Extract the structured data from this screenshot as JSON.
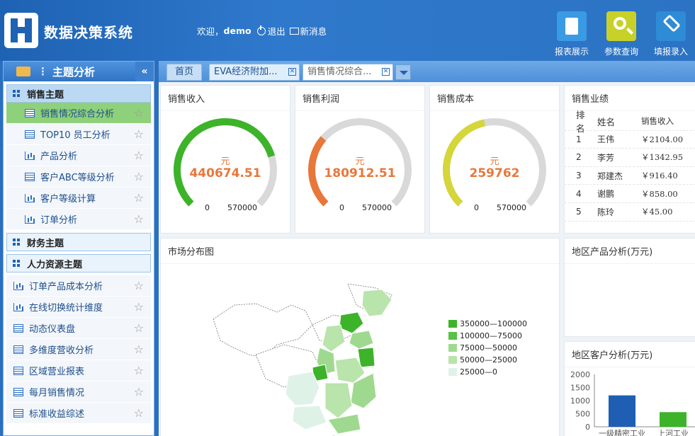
{
  "app": {
    "title": "数据决策系统"
  },
  "topbar": {
    "welcome": "欢迎，",
    "user": "demo",
    "logout": "退出",
    "messages": "新消息"
  },
  "toolbar": [
    {
      "label": "报表展示",
      "icon": "report-icon"
    },
    {
      "label": "参数查询",
      "icon": "search-icon"
    },
    {
      "label": "填报录入",
      "icon": "tag-icon"
    }
  ],
  "sidebar": {
    "title": "主题分析",
    "groups": {
      "sales": "销售主题",
      "finance": "财务主题",
      "hr": "人力资源主题"
    },
    "sales_items": [
      {
        "label": "销售情况综合分析",
        "icon": "list-icon"
      },
      {
        "label": "TOP10 员工分析",
        "icon": "list-icon"
      },
      {
        "label": "产品分析",
        "icon": "bar-chart-icon"
      },
      {
        "label": "客户ABC等级分析",
        "icon": "list-icon"
      },
      {
        "label": "客户等级计算",
        "icon": "bar-chart-icon"
      },
      {
        "label": "订单分析",
        "icon": "bar-chart-icon"
      }
    ],
    "top_items": [
      {
        "label": "订单产品成本分析",
        "icon": "bar-chart-icon"
      },
      {
        "label": "在线切换统计维度",
        "icon": "bar-chart-icon"
      },
      {
        "label": "动态仪表盘",
        "icon": "list-icon"
      },
      {
        "label": "多维度营收分析",
        "icon": "list-icon"
      },
      {
        "label": "区域营业报表",
        "icon": "list-icon"
      },
      {
        "label": "每月销售情况",
        "icon": "list-icon"
      },
      {
        "label": "标准收益综述",
        "icon": "list-icon"
      }
    ]
  },
  "tabs": {
    "home": "首页",
    "t1": "EVA经济附加...",
    "t2": "销售情况综合..."
  },
  "gauges": [
    {
      "title": "销售收入",
      "unit": "元",
      "value": "440674.51",
      "min": "0",
      "max": "570000",
      "color": "#3db32a",
      "ratio": 0.7731
    },
    {
      "title": "销售利润",
      "unit": "元",
      "value": "180912.51",
      "min": "0",
      "max": "570000",
      "color": "#e8773a",
      "ratio": 0.3174
    },
    {
      "title": "销售成本",
      "unit": "元",
      "value": "259762",
      "min": "0",
      "max": "570000",
      "color": "#d4d63a",
      "ratio": 0.4557
    }
  ],
  "ranking": {
    "title": "销售业绩",
    "headers": [
      "排名",
      "姓名",
      "销售收入"
    ],
    "rows": [
      [
        "1",
        "王伟",
        "￥2104.00"
      ],
      [
        "2",
        "李芳",
        "￥1342.95"
      ],
      [
        "3",
        "郑建杰",
        "￥916.40"
      ],
      [
        "4",
        "谢鹏",
        "￥858.00"
      ],
      [
        "5",
        "陈玲",
        "￥45.00"
      ]
    ]
  },
  "market": {
    "title": "市场分布图",
    "legend": [
      {
        "label": "350000—100000",
        "color": "#3db32a"
      },
      {
        "label": "100000—75000",
        "color": "#58c245"
      },
      {
        "label": "75000—50000",
        "color": "#9fd98f"
      },
      {
        "label": "50000—25000",
        "color": "#b9e4ac"
      },
      {
        "label": "25000—0",
        "color": "#dff2e8"
      }
    ]
  },
  "region_product": {
    "title": "地区产品分析(万元)"
  },
  "region_customer": {
    "title": "地区客户分析(万元)"
  },
  "chart_data": {
    "type": "bar",
    "categories": [
      "一级精密工业",
      "上河工业"
    ],
    "values": [
      1200,
      560
    ],
    "colors": [
      "#1e5fb3",
      "#3db32a"
    ],
    "yticks": [
      0,
      500,
      1000,
      1500,
      2000
    ],
    "ylim": [
      0,
      2000
    ]
  }
}
